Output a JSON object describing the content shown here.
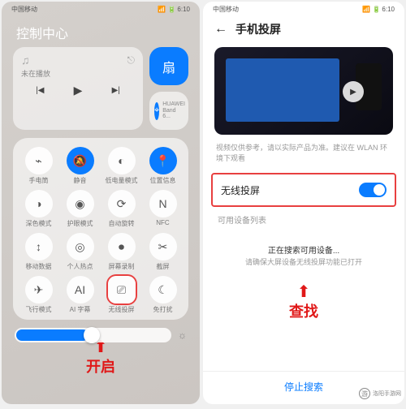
{
  "statusbar": {
    "carrier": "中国移动",
    "time": "6:10"
  },
  "left": {
    "title": "控制中心",
    "music_status": "未在播放",
    "bt_device": "HUAWEI Band 6...",
    "toggles": [
      {
        "icon": "flashlight",
        "label": "手电筒",
        "on": false
      },
      {
        "icon": "mute",
        "label": "静音",
        "on": true
      },
      {
        "icon": "battery",
        "label": "低电量模式",
        "on": false
      },
      {
        "icon": "location",
        "label": "位置信息",
        "on": true
      },
      {
        "icon": "dark",
        "label": "深色模式",
        "on": false
      },
      {
        "icon": "eye",
        "label": "护眼模式",
        "on": false
      },
      {
        "icon": "rotate",
        "label": "自动旋转",
        "on": false
      },
      {
        "icon": "nfc",
        "label": "NFC",
        "on": false
      },
      {
        "icon": "data",
        "label": "移动数据",
        "on": false
      },
      {
        "icon": "hotspot",
        "label": "个人热点",
        "on": false
      },
      {
        "icon": "record",
        "label": "屏幕录制",
        "on": false
      },
      {
        "icon": "shot",
        "label": "截屏",
        "on": false
      },
      {
        "icon": "airplane",
        "label": "飞行模式",
        "on": false
      },
      {
        "icon": "ai",
        "label": "AI 字幕",
        "on": false
      },
      {
        "icon": "cast",
        "label": "无线投屏",
        "on": false,
        "hl": true
      },
      {
        "icon": "dnd",
        "label": "免打扰",
        "on": false
      }
    ],
    "annotation": "开启"
  },
  "right": {
    "title": "手机投屏",
    "desc": "视频仅供参考，请以实际产品为准。建议在 WLAN 环境下观看",
    "wireless_label": "无线投屏",
    "available_label": "可用设备列表",
    "searching": "正在搜索可用设备...",
    "searching_sub": "请确保大屏设备无线投屏功能已打开",
    "annotation": "查找",
    "stop": "停止搜索"
  },
  "watermark": "洛阳手游网"
}
